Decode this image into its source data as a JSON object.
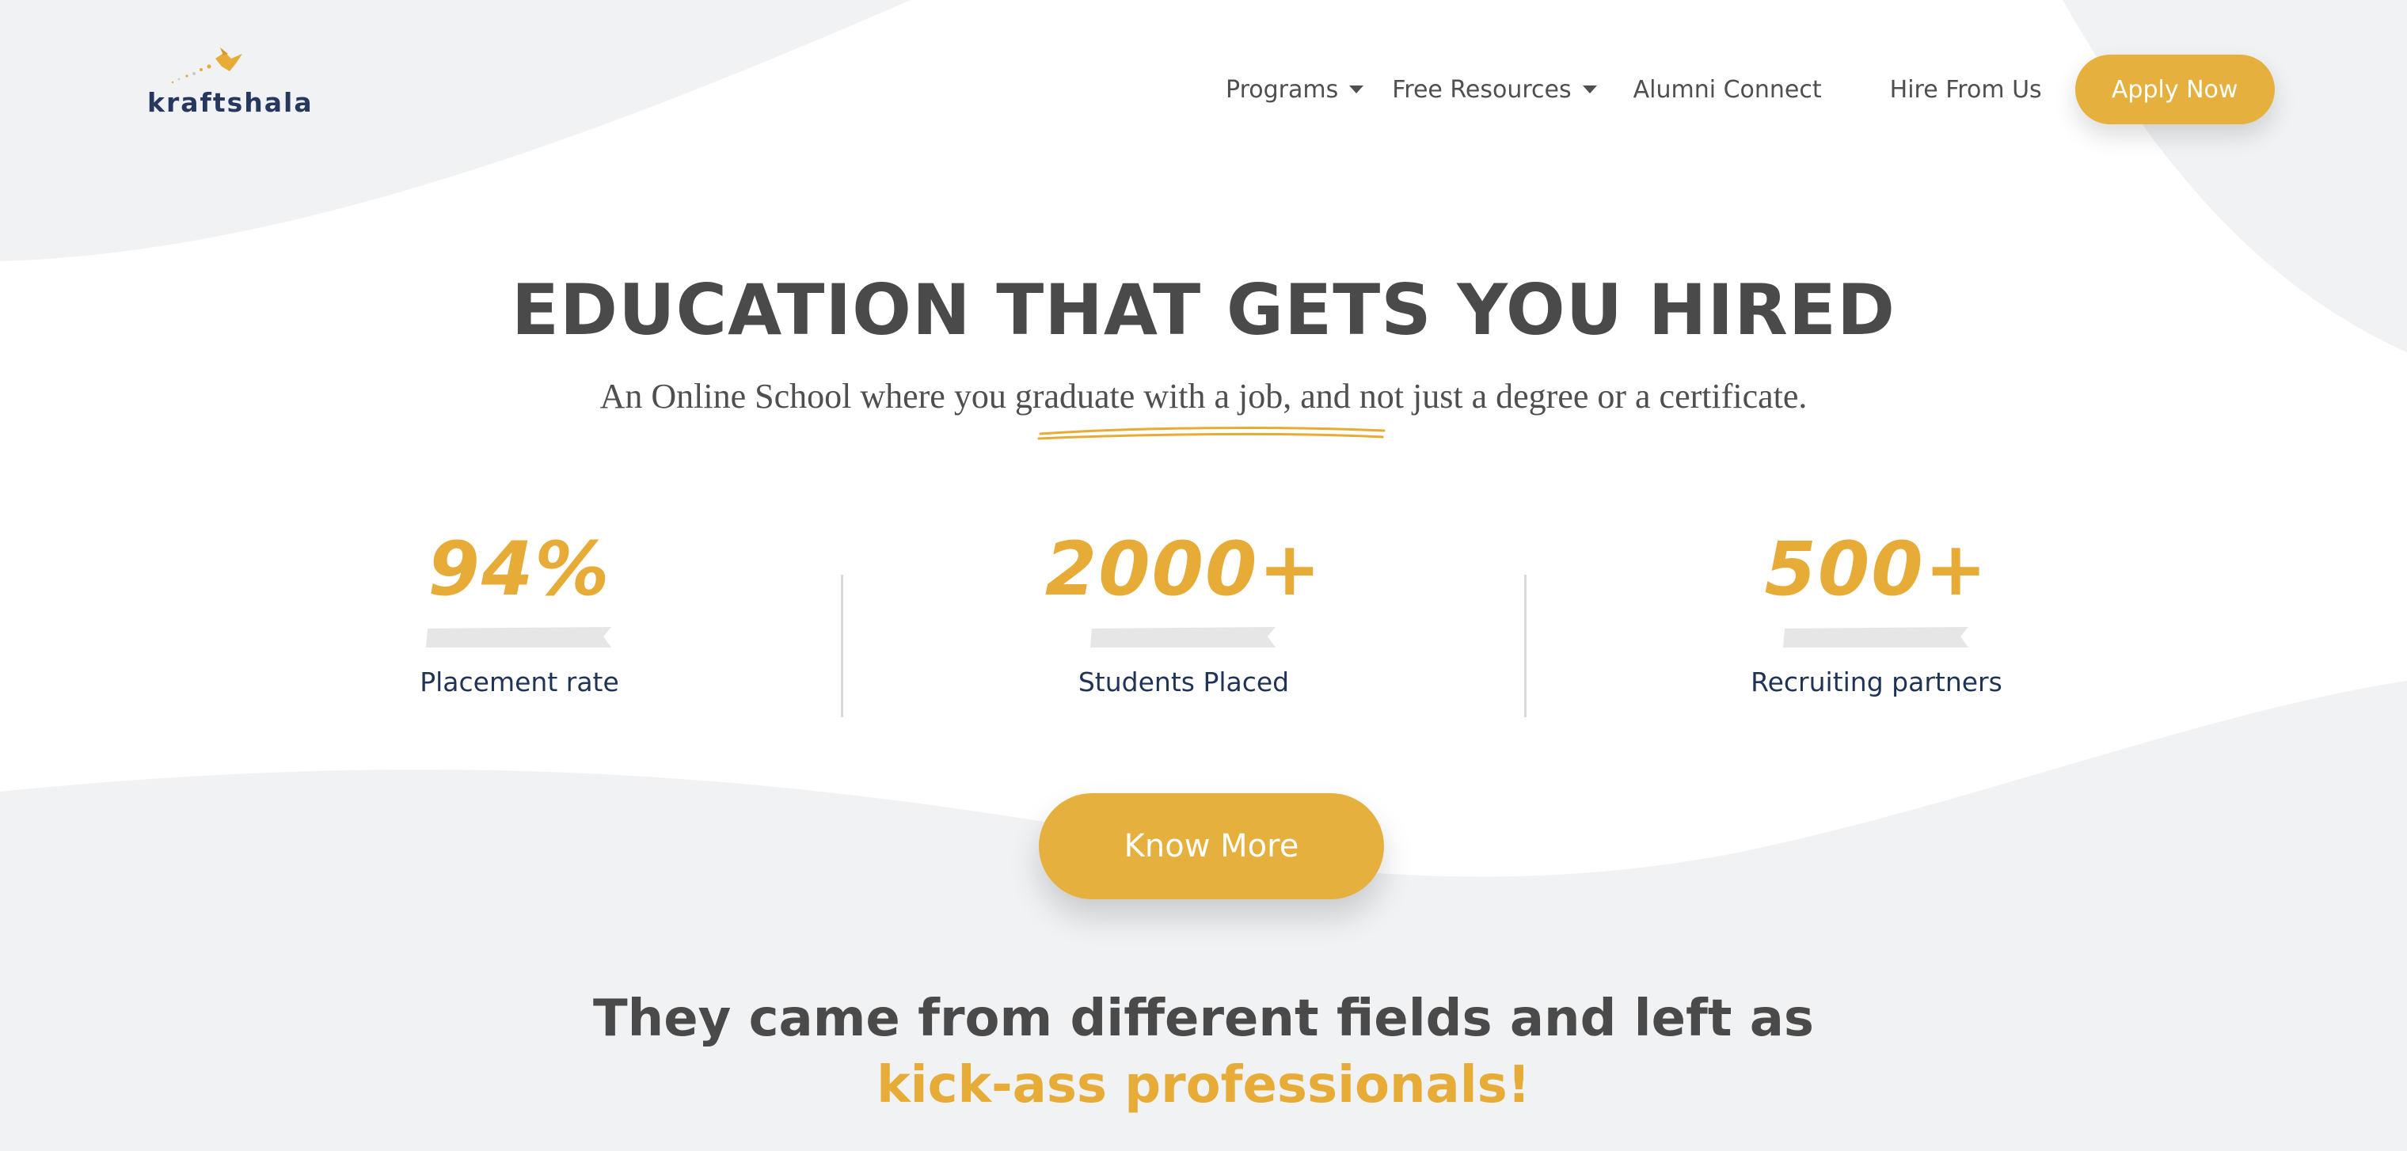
{
  "brand": {
    "name": "kraftshala",
    "accent_color": "#e6b03e",
    "text_color": "#26385f"
  },
  "nav": {
    "items": [
      {
        "label": "Programs",
        "has_dropdown": true
      },
      {
        "label": "Free Resources",
        "has_dropdown": true
      },
      {
        "label": "Alumni Connect",
        "has_dropdown": false
      },
      {
        "label": "Hire From Us",
        "has_dropdown": false
      }
    ],
    "cta_label": "Apply Now"
  },
  "hero": {
    "title": "EDUCATION THAT GETS YOU HIRED",
    "subtitle": "An Online School where you graduate with a job, and not just a degree or a certificate."
  },
  "stats": [
    {
      "number": "94%",
      "label": "Placement rate"
    },
    {
      "number": "2000+",
      "label": "Students Placed"
    },
    {
      "number": "500+",
      "label": "Recruiting partners"
    }
  ],
  "cta": {
    "know_more_label": "Know More"
  },
  "testimonials_heading": {
    "line1": "They came from different fields and left as",
    "line2": "kick-ass professionals!"
  }
}
